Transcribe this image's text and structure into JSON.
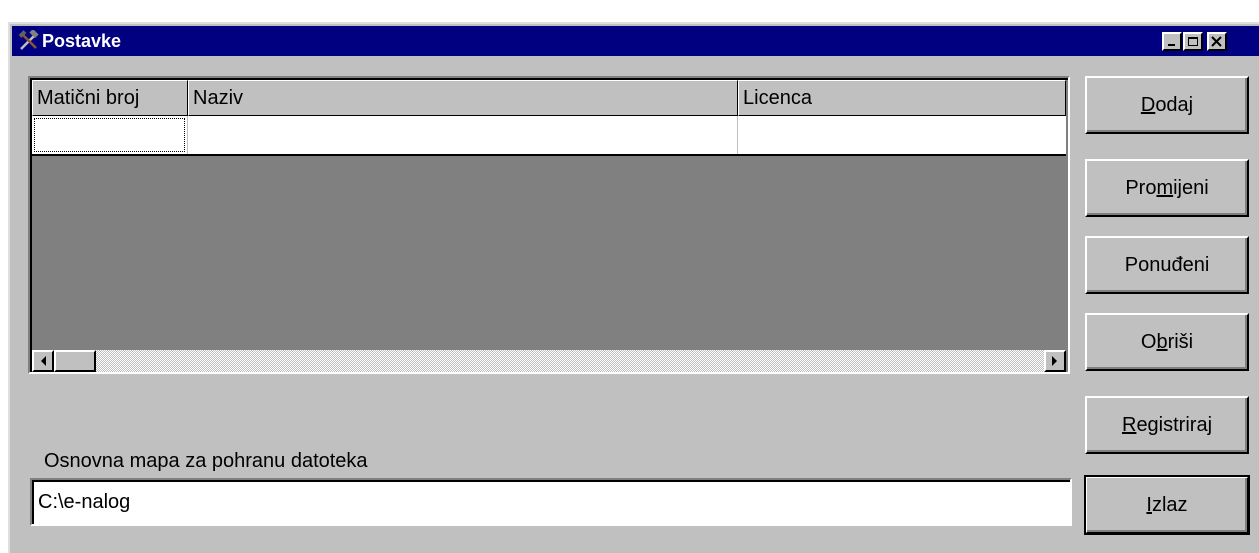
{
  "window": {
    "title": "Postavke"
  },
  "grid": {
    "columns": [
      "Matični broj",
      "Naziv",
      "Licenca"
    ],
    "rows": [
      [
        "",
        "",
        ""
      ]
    ]
  },
  "buttons": [
    {
      "pre": "",
      "accel": "D",
      "post": "odaj"
    },
    {
      "pre": "Pro",
      "accel": "m",
      "post": "ijeni"
    },
    {
      "pre": "Ponuđeni",
      "accel": "",
      "post": ""
    },
    {
      "pre": "O",
      "accel": "b",
      "post": "riši"
    },
    {
      "pre": "",
      "accel": "R",
      "post": "egistriraj"
    },
    {
      "pre": "",
      "accel": "I",
      "post": "zlaz"
    }
  ],
  "storage": {
    "label": "Osnovna mapa za pohranu datoteka",
    "path": "C:\\e-nalog"
  },
  "icons": {
    "title_icon": "hammer-pick-icon",
    "minimize": "minimize-icon",
    "maximize": "maximize-icon",
    "close": "close-icon",
    "scroll_left": "arrow-left-icon",
    "scroll_right": "arrow-right-icon"
  },
  "colors": {
    "titlebar": "#000080",
    "face": "#c0c0c0",
    "grid_bg": "#808080"
  }
}
